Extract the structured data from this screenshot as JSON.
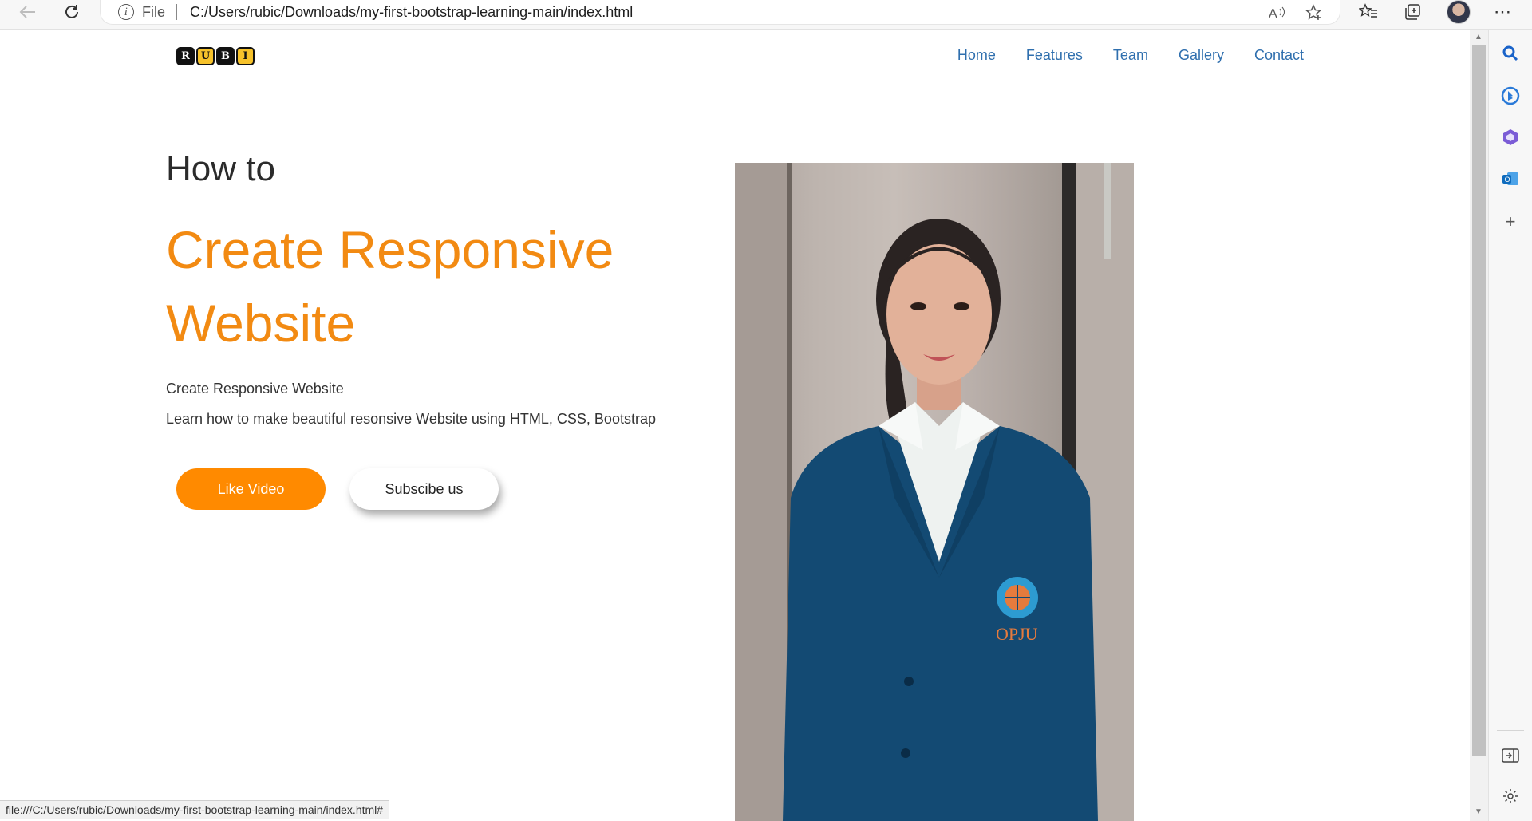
{
  "browser": {
    "scheme_label": "File",
    "url": "C:/Users/rubic/Downloads/my-first-bootstrap-learning-main/index.html",
    "status_url": "file:///C:/Users/rubic/Downloads/my-first-bootstrap-learning-main/index.html#",
    "icons": {
      "back": "back-arrow-icon",
      "refresh": "refresh-icon",
      "info": "info-icon",
      "read_aloud": "read-aloud-icon",
      "add_favorite": "add-favorite-icon",
      "favorites": "favorites-icon",
      "collections": "collections-icon",
      "profile": "profile-avatar",
      "more": "more-icon"
    }
  },
  "sidebar": {
    "icons": [
      "search-icon",
      "bing-chat-icon",
      "office-icon",
      "outlook-icon",
      "add-icon",
      "hide-sidebar-icon",
      "settings-icon"
    ]
  },
  "site": {
    "logo_letters": [
      "R",
      "U",
      "B",
      "I"
    ],
    "nav": [
      "Home",
      "Features",
      "Team",
      "Gallery",
      "Contact"
    ],
    "hero": {
      "eyebrow": "How to",
      "headline": "Create Responsive Website",
      "line1": "Create Responsive Website",
      "line2": "Learn how to make beautiful resonsive Website using HTML, CSS, Bootstrap",
      "primary_button": "Like Video",
      "secondary_button": "Subscibe us"
    },
    "photo_badge_text": "OPJU"
  },
  "colors": {
    "accent": "#f28a12",
    "button": "#ff8a00",
    "nav_link": "#2f6fae",
    "logo_yellow": "#f6c22b"
  }
}
